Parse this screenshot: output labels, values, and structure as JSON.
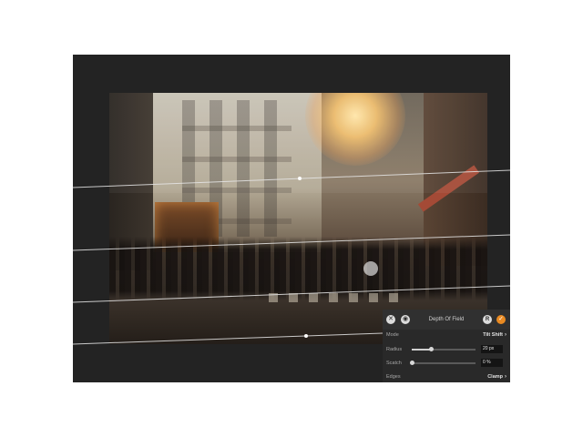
{
  "panel": {
    "title": "Depth Of Field",
    "reset_label": "R",
    "rows": {
      "mode": {
        "label": "Mode",
        "value": "Tilt Shift"
      },
      "radius": {
        "label": "Radius",
        "value": "20 px",
        "fraction": 0.3
      },
      "scratch": {
        "label": "Scatch",
        "value": "0 %",
        "fraction": 0.0
      },
      "edges": {
        "label": "Edges",
        "value": "Clamp"
      }
    }
  },
  "icons": {
    "cancel": "close-icon",
    "preview": "eye-icon",
    "apply": "checkmark-icon",
    "chevron": "chevron-right-icon"
  },
  "colors": {
    "accent": "#e98a22",
    "panel_bg": "#2a2a2a",
    "window_bg": "#232323"
  }
}
